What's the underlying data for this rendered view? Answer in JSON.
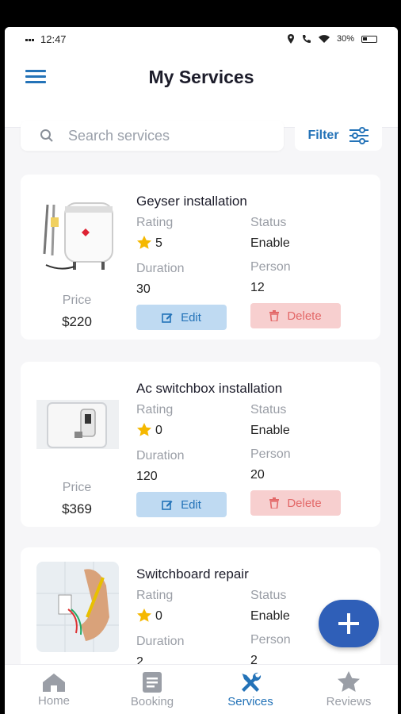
{
  "status_bar": {
    "time": "12:47",
    "battery": "30%"
  },
  "header": {
    "title": "My Services"
  },
  "search": {
    "placeholder": "Search services"
  },
  "filter": {
    "label": "Filter"
  },
  "labels": {
    "rating": "Rating",
    "status": "Status",
    "duration": "Duration",
    "person": "Person",
    "price": "Price",
    "edit": "Edit",
    "delete": "Delete"
  },
  "services": [
    {
      "name": "Geyser installation",
      "rating": "5",
      "status": "Enable",
      "duration": "30",
      "person": "12",
      "price": "$220",
      "image": "water-heater-image"
    },
    {
      "name": "Ac switchbox installation",
      "rating": "0",
      "status": "Enable",
      "duration": "120",
      "person": "20",
      "price": "$369",
      "image": "switchbox-image"
    },
    {
      "name": "Switchboard repair",
      "rating": "0",
      "status": "Enable",
      "duration": "2",
      "person": "2",
      "price": "",
      "image": "switchboard-repair-image"
    }
  ],
  "bottom_nav": [
    {
      "label": "Home",
      "icon": "home-icon"
    },
    {
      "label": "Booking",
      "icon": "booking-icon"
    },
    {
      "label": "Services",
      "icon": "tools-icon",
      "active": true
    },
    {
      "label": "Reviews",
      "icon": "star-icon"
    }
  ],
  "colors": {
    "accent": "#2473b8",
    "fab": "#2f5fb8",
    "star": "#f5b800",
    "delete": "#e36868"
  }
}
